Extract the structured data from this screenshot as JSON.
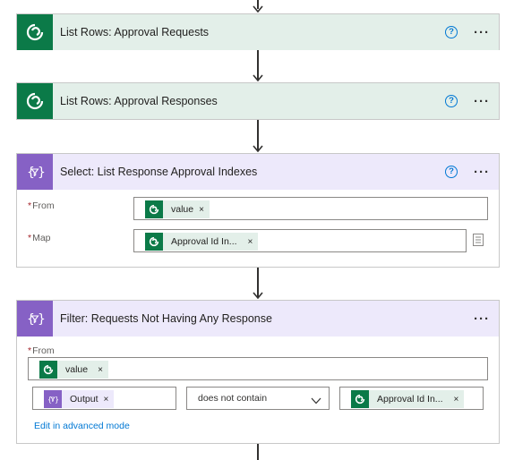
{
  "cards": [
    {
      "title": "List Rows: Approval Requests",
      "icon": "dataverse-icon",
      "has_help": true
    },
    {
      "title": "List Rows: Approval Responses",
      "icon": "dataverse-icon",
      "has_help": true
    },
    {
      "title": "Select: List Response Approval Indexes",
      "icon": "data-operation-icon",
      "has_help": true,
      "fields": {
        "from_label": "From",
        "from_token": "value",
        "map_label": "Map",
        "map_token": "Approval Id In..."
      }
    },
    {
      "title": "Filter: Requests Not Having Any Response",
      "icon": "data-operation-icon",
      "has_help": false,
      "fields": {
        "from_label": "From",
        "from_token": "value",
        "left_token": "Output",
        "operator": "does not contain",
        "right_token": "Approval Id In...",
        "advanced_link": "Edit in advanced mode"
      }
    }
  ],
  "required_marker": "*",
  "remove_glyph": "×",
  "help_glyph": "?",
  "more_glyph": "···",
  "colors": {
    "dataverse_green": "#0b7a48",
    "green_header": "#e3efe9",
    "purple_icon": "#8661c5",
    "purple_header": "#ede9fb",
    "link_blue": "#0078d4"
  }
}
